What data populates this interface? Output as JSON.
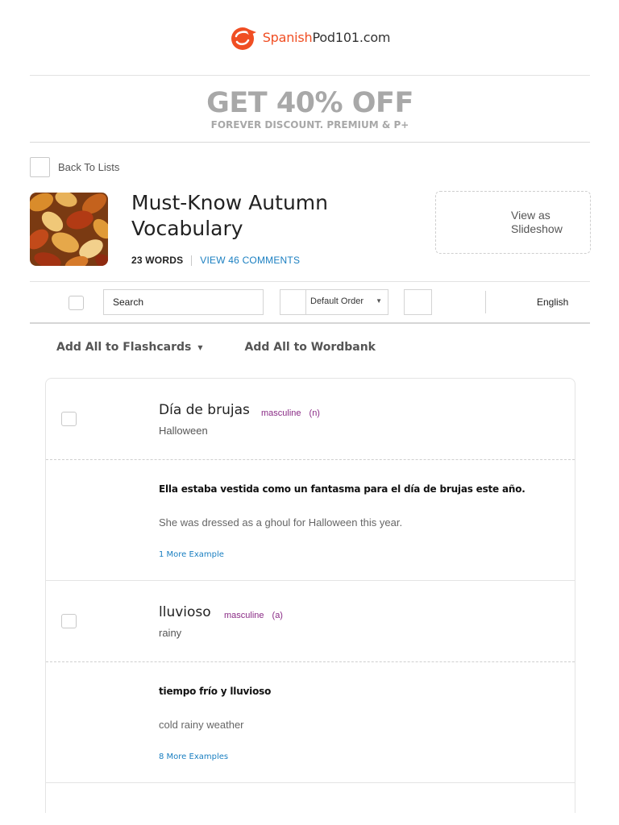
{
  "header": {
    "logo_brand": "Spanish",
    "logo_rest": "Pod101.com"
  },
  "promo": {
    "title": "GET 40% OFF",
    "subtitle": "FOREVER DISCOUNT. PREMIUM & P+"
  },
  "back_link": {
    "label": "Back To Lists"
  },
  "list": {
    "title": "Must-Know Autumn Vocabulary",
    "word_count": "23 WORDS",
    "comments_link": "VIEW 46 COMMENTS",
    "slideshow_label": "View as Slideshow"
  },
  "toolbar": {
    "search_placeholder": "Search",
    "sort_selected": "Default Order",
    "language": "English"
  },
  "actions": {
    "flashcards_label": "Add All to Flashcards",
    "wordbank_label": "Add All to Wordbank"
  },
  "entries": [
    {
      "word": "Día de brujas",
      "gender": "masculine",
      "pos": "(n)",
      "translation": "Halloween",
      "example_es": "Ella estaba vestida como un fantasma para el día de brujas este año.",
      "example_en": "She was dressed as a ghoul for Halloween this year.",
      "more_examples": "1 More Example"
    },
    {
      "word": "lluvioso",
      "gender": "masculine",
      "pos": "(a)",
      "translation": "rainy",
      "example_es": "tiempo frío y lluvioso",
      "example_en": "cold rainy weather",
      "more_examples": "8 More Examples"
    }
  ],
  "colors": {
    "brand_orange": "#f04e23",
    "link_blue": "#1a7fc1",
    "tag_purple": "#8a2c86",
    "promo_gray": "#a8a8a8"
  }
}
